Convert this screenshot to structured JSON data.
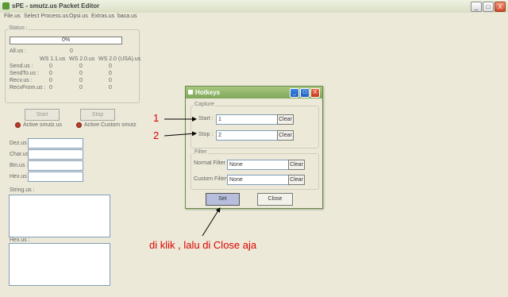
{
  "window": {
    "title": "sPE - smutz.us Packet Editor",
    "minimize": "_",
    "maximize": "□",
    "close": "X"
  },
  "menu": [
    "File.us",
    "Select Process.us",
    "Opsi.us",
    "Extras.us",
    "baca.us"
  ],
  "status": {
    "label": "Status :",
    "progress_percent": 0,
    "progress_text": "0%",
    "all_label": "All.us :",
    "all_value": "0",
    "columns": [
      "WS 1.1.us",
      "WS 2.0.us",
      "WS 2.0 (USA).us"
    ],
    "rows": [
      {
        "label": "Send.us :",
        "values": [
          "0",
          "0",
          "0"
        ]
      },
      {
        "label": "SendTo.us :",
        "values": [
          "0",
          "0",
          "0"
        ]
      },
      {
        "label": "Recv.us :",
        "values": [
          "0",
          "0",
          "0"
        ]
      },
      {
        "label": "RecvFrom.us :",
        "values": [
          "0",
          "0",
          "0"
        ]
      }
    ]
  },
  "controls": {
    "start": "Start",
    "stop": "Stop",
    "active_smutz": "Active smutz.us",
    "active_custom": "Active Custom smutz"
  },
  "converter": {
    "dec_label": "Dez.us :",
    "char_label": "Char.us :",
    "bin_label": "Bin.us :",
    "hex_label": "Hex.us :",
    "string_label": "String.us :",
    "hexarea_label": "Hex.us :"
  },
  "hotkeys": {
    "title": "Hotkeys",
    "capture_label": "Capture",
    "start_label": "Start :",
    "start_value": "1",
    "stop_label": "Stop :",
    "stop_value": "2",
    "clear": "Clear",
    "filter_label": "Filter",
    "normal_filter_label": "Normal Filter :",
    "normal_filter_value": "None",
    "custom_filter_label": "Custom Filter :",
    "custom_filter_value": "None",
    "set": "Set",
    "close": "Close"
  },
  "annotations": {
    "num1": "1",
    "num2": "2",
    "note": "di klik , lalu di Close aja"
  }
}
